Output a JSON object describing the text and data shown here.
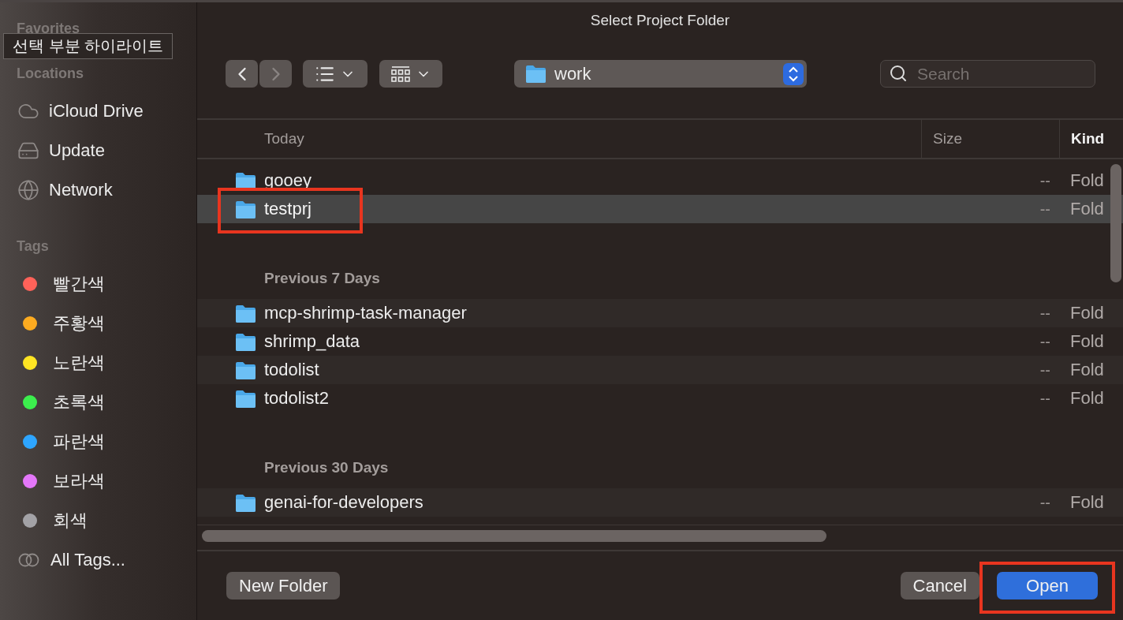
{
  "window": {
    "title": "Select Project Folder"
  },
  "sidebar": {
    "sections": [
      {
        "heading": "Favorites"
      },
      {
        "heading": "Locations",
        "items": [
          {
            "label": "iCloud Drive",
            "kind": "cloud"
          },
          {
            "label": "Update",
            "kind": "drive"
          },
          {
            "label": "Network",
            "kind": "network"
          }
        ]
      },
      {
        "heading": "Tags",
        "items": [
          {
            "label": "빨간색",
            "kind": "tag",
            "color": "#ff6259"
          },
          {
            "label": "주황색",
            "kind": "tag",
            "color": "#fdab20"
          },
          {
            "label": "노란색",
            "kind": "tag",
            "color": "#ffe523"
          },
          {
            "label": "초록색",
            "kind": "tag",
            "color": "#3cee4d"
          },
          {
            "label": "파란색",
            "kind": "tag",
            "color": "#2ea5ff"
          },
          {
            "label": "보라색",
            "kind": "tag",
            "color": "#e477f9"
          },
          {
            "label": "회색",
            "kind": "tag",
            "color": "#a3a2a6"
          },
          {
            "label": "All Tags...",
            "kind": "all-tags"
          }
        ]
      }
    ]
  },
  "tooltip": "선택 부분 하이라이트",
  "toolbar": {
    "path": "work",
    "search": {
      "placeholder": "Search"
    }
  },
  "table": {
    "columns": [
      {
        "label": "Today",
        "sorted": false
      },
      {
        "label": "Size",
        "sorted": false
      },
      {
        "label": "Kind",
        "sorted": true
      }
    ],
    "groups": [
      {
        "rows": [
          {
            "name": "gooey",
            "size": "--",
            "kind": "Fold",
            "selected": false,
            "highlighted": false
          },
          {
            "name": "testprj",
            "size": "--",
            "kind": "Fold",
            "selected": true,
            "highlighted": true
          }
        ]
      },
      {
        "label": "Previous 7 Days",
        "rows": [
          {
            "name": "mcp-shrimp-task-manager",
            "size": "--",
            "kind": "Fold",
            "selected": false,
            "highlighted": false
          },
          {
            "name": "shrimp_data",
            "size": "--",
            "kind": "Fold",
            "selected": false,
            "highlighted": false
          },
          {
            "name": "todolist",
            "size": "--",
            "kind": "Fold",
            "selected": false,
            "highlighted": false
          },
          {
            "name": "todolist2",
            "size": "--",
            "kind": "Fold",
            "selected": false,
            "highlighted": false
          }
        ]
      },
      {
        "label": "Previous 30 Days",
        "rows": [
          {
            "name": "genai-for-developers",
            "size": "--",
            "kind": "Fold",
            "selected": false,
            "highlighted": false
          }
        ]
      }
    ]
  },
  "buttons": [
    {
      "label": "New Folder",
      "kind": "secondary",
      "highlighted": false
    },
    {
      "label": "Cancel",
      "kind": "secondary",
      "highlighted": false
    },
    {
      "label": "Open",
      "kind": "primary",
      "highlighted": true
    }
  ]
}
